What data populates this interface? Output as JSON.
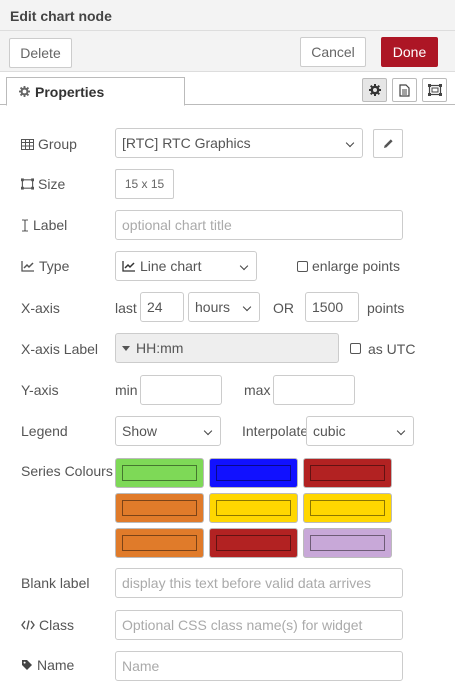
{
  "window": {
    "title": "Edit chart node"
  },
  "actions": {
    "delete": "Delete",
    "cancel": "Cancel",
    "done": "Done"
  },
  "tabs": {
    "properties": "Properties"
  },
  "form": {
    "group": {
      "label": "Group",
      "value": "[RTC] RTC Graphics"
    },
    "size": {
      "label": "Size",
      "value": "15 x 15"
    },
    "chart_label": {
      "label": "Label",
      "placeholder": "optional chart title"
    },
    "type": {
      "label": "Type",
      "value": "Line chart",
      "enlarge_label": "enlarge points"
    },
    "xaxis": {
      "label": "X-axis",
      "last_label": "last",
      "value": "24",
      "unit": "hours",
      "or_label": "OR",
      "points": "1500",
      "points_label": "points"
    },
    "xaxis_label": {
      "label": "X-axis Label",
      "value": "HH:mm",
      "utc_label": "as UTC"
    },
    "yaxis": {
      "label": "Y-axis",
      "min_label": "min",
      "max_label": "max"
    },
    "legend": {
      "label": "Legend",
      "value": "Show",
      "interpolate_label": "Interpolate",
      "interpolate_value": "cubic"
    },
    "series": {
      "label": "Series Colours",
      "colors": [
        "#7ed957",
        "#1111ff",
        "#b22222",
        "#e07b2a",
        "#ffd700",
        "#ffd700",
        "#e07b2a",
        "#b22222",
        "#c8a8d8"
      ]
    },
    "blank": {
      "label": "Blank label",
      "placeholder": "display this text before valid data arrives"
    },
    "class": {
      "label": "Class",
      "placeholder": "Optional CSS class name(s) for widget"
    },
    "name": {
      "label": "Name",
      "placeholder": "Name"
    }
  }
}
